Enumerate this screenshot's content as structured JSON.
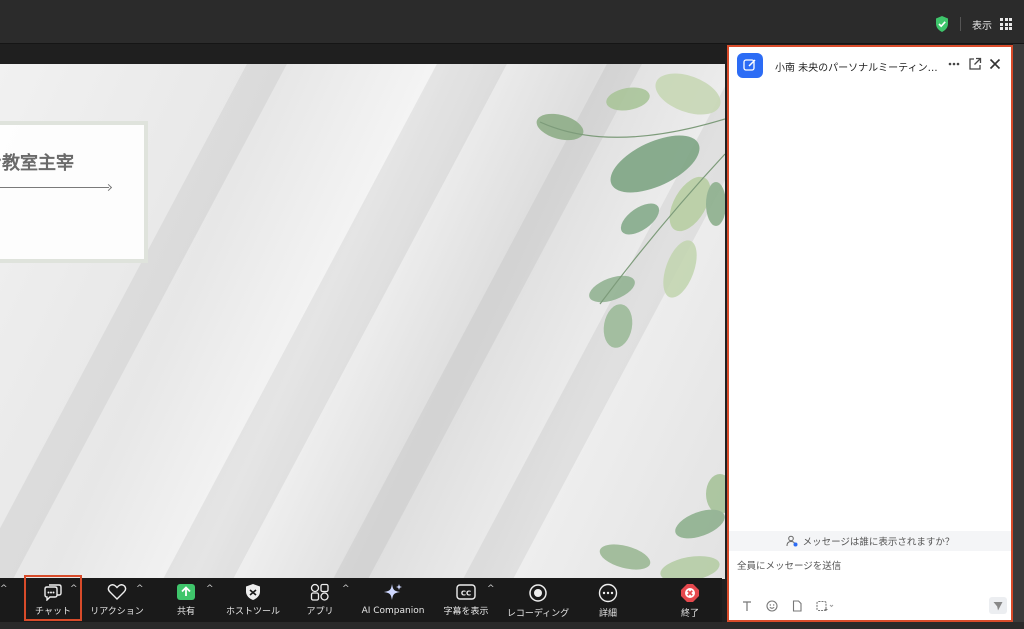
{
  "titlebar": {
    "view_label": "表示",
    "shield_icon": "shield-check-icon",
    "view_icon": "grid-view-icon",
    "shield_color": "#3ec56b"
  },
  "slide": {
    "title": "ン教室主宰"
  },
  "toolbar": {
    "items": [
      {
        "icon": "chat-icon",
        "label": "チャット",
        "caret": true
      },
      {
        "icon": "heart-icon",
        "label": "リアクション",
        "caret": true
      },
      {
        "icon": "share-screen-icon",
        "label": "共有",
        "caret": true
      },
      {
        "icon": "host-tools-shield-icon",
        "label": "ホストツール",
        "caret": false
      },
      {
        "icon": "apps-icon",
        "label": "アプリ",
        "caret": true
      },
      {
        "icon": "sparkle-icon",
        "label": "AI Companion",
        "caret": false
      },
      {
        "icon": "cc-icon",
        "label": "字幕を表示",
        "caret": true
      },
      {
        "icon": "record-icon",
        "label": "レコーディング",
        "caret": false
      },
      {
        "icon": "more-icon",
        "label": "詳細",
        "caret": false
      },
      {
        "icon": "end-icon",
        "label": "終了",
        "caret": false
      }
    ],
    "highlight_color": "#d84b2a",
    "share_color": "#3fc56b",
    "end_color": "#e5484d"
  },
  "chat": {
    "title": "小南 未央のパーソナルミーティング…",
    "who_can_see": "メッセージは誰に表示されますか？",
    "input_placeholder": "全員にメッセージを送信",
    "header_icons": [
      "more-icon",
      "pop-out-icon",
      "close-icon"
    ],
    "composer_icons": [
      "text-format-icon",
      "emoji-icon",
      "file-icon",
      "screenshot-icon",
      "send-icon"
    ],
    "accent_color": "#2c6cf5"
  }
}
